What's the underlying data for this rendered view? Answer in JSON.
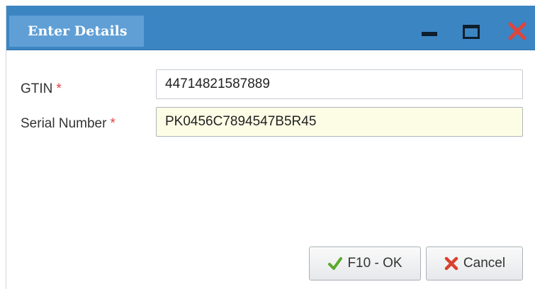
{
  "dialog": {
    "title": "Enter Details"
  },
  "fields": {
    "gtin": {
      "label": "GTIN",
      "required_mark": "*",
      "value": "44714821587889"
    },
    "serial": {
      "label": "Serial Number",
      "required_mark": "*",
      "value": "PK0456C7894547B5R45"
    }
  },
  "buttons": {
    "ok_label": "F10 - OK",
    "cancel_label": "Cancel"
  },
  "icons": {
    "ok": "check-icon",
    "cancel": "x-icon",
    "window": [
      "minimize-icon",
      "maximize-icon",
      "close-icon"
    ]
  },
  "colors": {
    "titlebar": "#3c85c3",
    "title_tab": "#5f9fd6",
    "required": "#e34040",
    "active_field": "#fdfde6",
    "ok_check": "#5aaa2a",
    "cancel_x": "#d9412e",
    "close_icon": "#e0443a"
  }
}
